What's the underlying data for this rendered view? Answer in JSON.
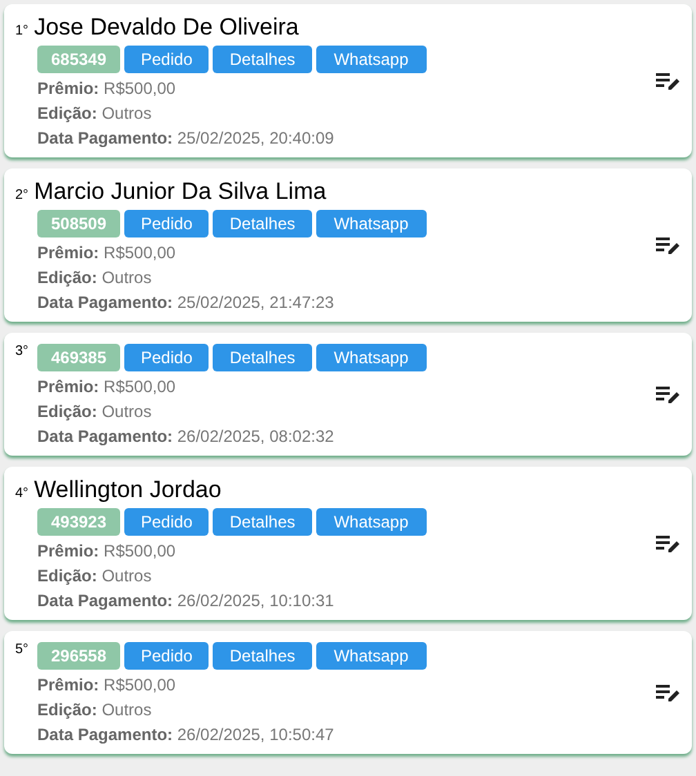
{
  "entries": [
    {
      "rank": "1°",
      "name": "Jose Devaldo De Oliveira",
      "code": "685349",
      "buttons": [
        "Pedido",
        "Detalhes",
        "Whatsapp"
      ],
      "fields": [
        {
          "label": "Prêmio:",
          "value": "R$500,00"
        },
        {
          "label": "Edição:",
          "value": "Outros"
        },
        {
          "label": "Data Pagamento:",
          "value": "25/02/2025, 20:40:09"
        }
      ]
    },
    {
      "rank": "2°",
      "name": "Marcio Junior Da Silva Lima",
      "code": "508509",
      "buttons": [
        "Pedido",
        "Detalhes",
        "Whatsapp"
      ],
      "fields": [
        {
          "label": "Prêmio:",
          "value": "R$500,00"
        },
        {
          "label": "Edição:",
          "value": "Outros"
        },
        {
          "label": "Data Pagamento:",
          "value": "25/02/2025, 21:47:23"
        }
      ]
    },
    {
      "rank": "3°",
      "code": "469385",
      "buttons": [
        "Pedido",
        "Detalhes",
        "Whatsapp"
      ],
      "fields": [
        {
          "label": "Prêmio:",
          "value": "R$500,00"
        },
        {
          "label": "Edição:",
          "value": "Outros"
        },
        {
          "label": "Data Pagamento:",
          "value": "26/02/2025, 08:02:32"
        }
      ]
    },
    {
      "rank": "4°",
      "name": "Wellington Jordao",
      "code": "493923",
      "buttons": [
        "Pedido",
        "Detalhes",
        "Whatsapp"
      ],
      "fields": [
        {
          "label": "Prêmio:",
          "value": "R$500,00"
        },
        {
          "label": "Edição:",
          "value": "Outros"
        },
        {
          "label": "Data Pagamento:",
          "value": "26/02/2025, 10:10:31"
        }
      ]
    },
    {
      "rank": "5°",
      "code": "296558",
      "buttons": [
        "Pedido",
        "Detalhes",
        "Whatsapp"
      ],
      "fields": [
        {
          "label": "Prêmio:",
          "value": "R$500,00"
        },
        {
          "label": "Edição:",
          "value": "Outros"
        },
        {
          "label": "Data Pagamento:",
          "value": "26/02/2025, 10:50:47"
        }
      ]
    }
  ]
}
